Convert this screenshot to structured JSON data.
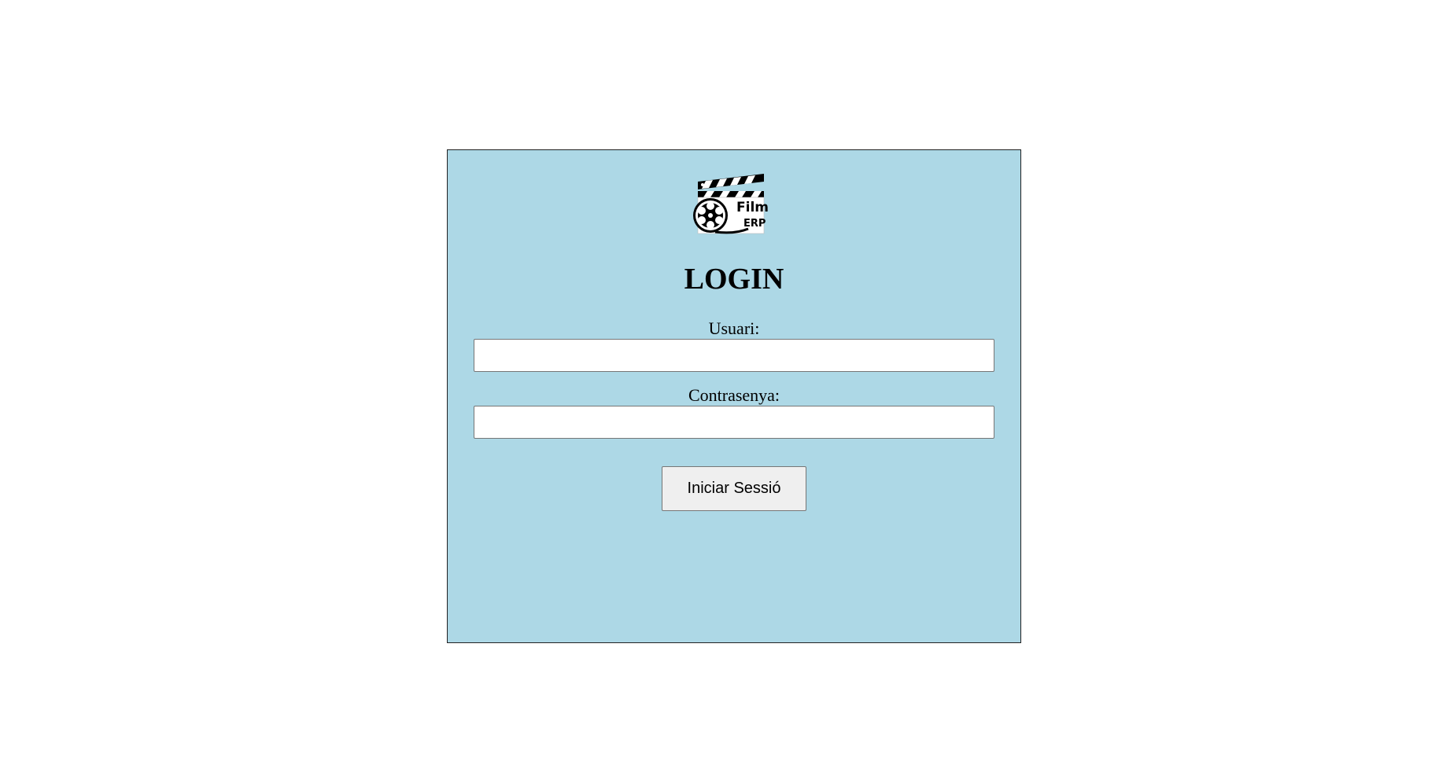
{
  "logo": {
    "line1": "Film",
    "line2": "ERP",
    "icon": "film-clapperboard-reel-icon"
  },
  "login": {
    "title": "LOGIN",
    "username_label": "Usuari:",
    "username_value": "",
    "password_label": "Contrasenya:",
    "password_value": "",
    "submit_label": "Iniciar Sessió"
  },
  "colors": {
    "panel_background": "#add8e6",
    "panel_border": "#222222",
    "button_background": "#efefef"
  }
}
